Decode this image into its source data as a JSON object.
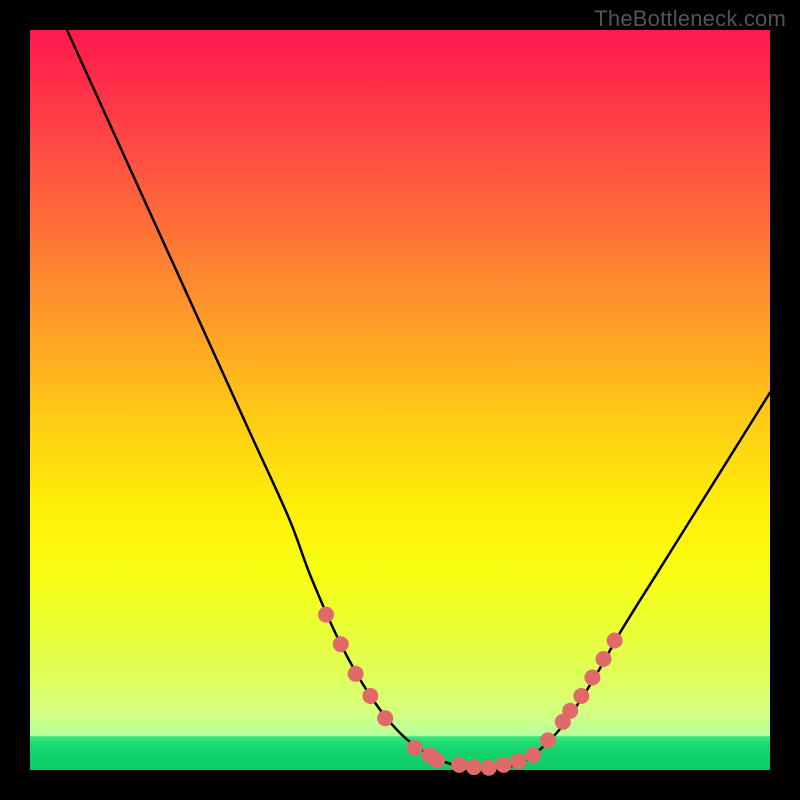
{
  "watermark": "TheBottleneck.com",
  "chart_data": {
    "type": "line",
    "title": "",
    "xlabel": "",
    "ylabel": "",
    "xlim": [
      0,
      100
    ],
    "ylim": [
      0,
      100
    ],
    "grid": false,
    "legend": false,
    "series": [
      {
        "name": "curve",
        "color": "#000000",
        "x": [
          5,
          10,
          15,
          20,
          25,
          30,
          35,
          38,
          42,
          46,
          50,
          54,
          58,
          62,
          65,
          68,
          72,
          76,
          80,
          85,
          90,
          95,
          100
        ],
        "y": [
          100,
          89,
          78,
          67,
          56,
          45,
          34,
          26,
          17,
          10,
          5,
          2,
          0.5,
          0,
          0.5,
          2,
          6,
          12,
          19,
          27,
          35,
          43,
          51
        ]
      }
    ],
    "markers": {
      "name": "highlight-dots",
      "color": "#e06a6a",
      "radius": 8,
      "points": [
        {
          "x": 40,
          "y": 21
        },
        {
          "x": 42,
          "y": 17
        },
        {
          "x": 44,
          "y": 13
        },
        {
          "x": 46,
          "y": 10
        },
        {
          "x": 48,
          "y": 7
        },
        {
          "x": 52,
          "y": 3
        },
        {
          "x": 54,
          "y": 2
        },
        {
          "x": 55,
          "y": 1.3
        },
        {
          "x": 58,
          "y": 0.7
        },
        {
          "x": 60,
          "y": 0.4
        },
        {
          "x": 62,
          "y": 0.3
        },
        {
          "x": 64,
          "y": 0.7
        },
        {
          "x": 66,
          "y": 1.2
        },
        {
          "x": 68,
          "y": 2
        },
        {
          "x": 70,
          "y": 4
        },
        {
          "x": 72,
          "y": 6.5
        },
        {
          "x": 73,
          "y": 8
        },
        {
          "x": 74.5,
          "y": 10
        },
        {
          "x": 76,
          "y": 12.5
        },
        {
          "x": 77.5,
          "y": 15
        },
        {
          "x": 79,
          "y": 17.5
        }
      ]
    }
  }
}
